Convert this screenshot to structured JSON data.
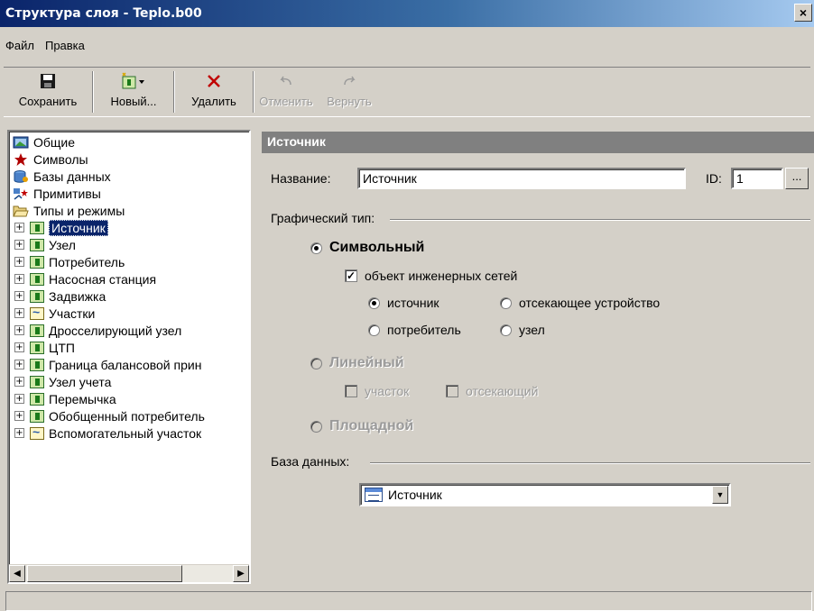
{
  "window": {
    "title": "Структура слоя - Teplo.b00",
    "close": "×"
  },
  "menu": [
    {
      "label": "Файл"
    },
    {
      "label": "Правка"
    }
  ],
  "toolbar": {
    "save": "Сохранить",
    "new": "Новый...",
    "delete": "Удалить",
    "undo": "Отменить",
    "redo": "Вернуть"
  },
  "tree": {
    "root": [
      {
        "label": "Общие",
        "icon": "general-icon"
      },
      {
        "label": "Символы",
        "icon": "star-icon"
      },
      {
        "label": "Базы данных",
        "icon": "database-icon"
      },
      {
        "label": "Примитивы",
        "icon": "primitives-icon"
      },
      {
        "label": "Типы и режимы",
        "icon": "folder-open-icon"
      }
    ],
    "types": [
      {
        "label": "Источник",
        "icon": "flag",
        "selected": true
      },
      {
        "label": "Узел",
        "icon": "flag"
      },
      {
        "label": "Потребитель",
        "icon": "flag"
      },
      {
        "label": "Насосная станция",
        "icon": "flag"
      },
      {
        "label": "Задвижка",
        "icon": "flag"
      },
      {
        "label": "Участки",
        "icon": "graph"
      },
      {
        "label": "Дросселирующий узел",
        "icon": "flag"
      },
      {
        "label": "ЦТП",
        "icon": "flag"
      },
      {
        "label": "Граница балансовой прин",
        "icon": "flag"
      },
      {
        "label": "Узел учета",
        "icon": "flag"
      },
      {
        "label": "Перемычка",
        "icon": "flag"
      },
      {
        "label": "Обобщенный потребитель",
        "icon": "flag"
      },
      {
        "label": "Вспомогательный участок",
        "icon": "graph"
      }
    ],
    "expander": "+"
  },
  "panel": {
    "header": "Источник",
    "name_label": "Название:",
    "name_value": "Источник",
    "id_label": "ID:",
    "id_value": "1",
    "browse": "...",
    "graphic_type_label": "Графический тип:",
    "symbolic": "Символьный",
    "engineering_networks": "объект инженерных сетей",
    "source": "источник",
    "cutoff_device": "отсекающее устройство",
    "consumer": "потребитель",
    "node": "узел",
    "linear": "Линейный",
    "segment": "участок",
    "cutting": "отсекающий",
    "area": "Площадной",
    "database_label": "База данных:",
    "database_value": "Источник"
  },
  "colors": {
    "titlebar_start": "#0a246a",
    "titlebar_end": "#a6caf0",
    "selection": "#0a246a",
    "panel_header": "#808080"
  }
}
